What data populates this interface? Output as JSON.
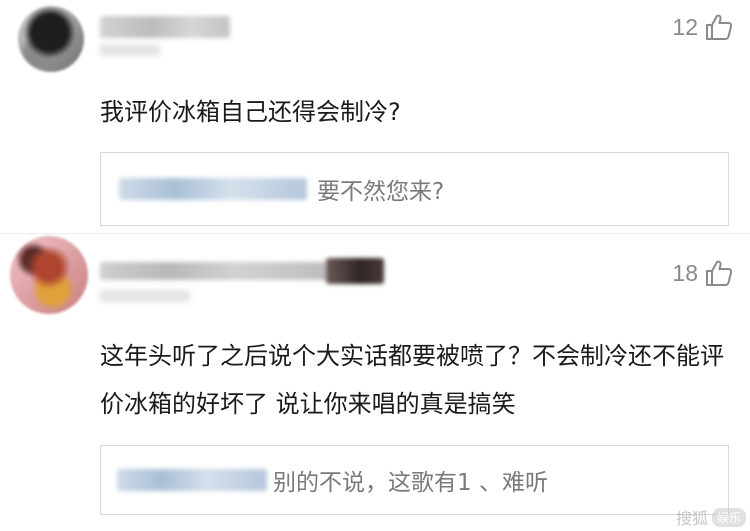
{
  "comments": [
    {
      "avatar_icon": "user-avatar-icon",
      "username_blurred": true,
      "likes": "12",
      "like_icon": "thumbs-up-icon",
      "text": "我评价冰箱自己还得会制冷?",
      "reply": {
        "author_blurred": true,
        "text": "要不然您来?"
      }
    },
    {
      "avatar_icon": "user-avatar-icon",
      "username_blurred": true,
      "likes": "18",
      "like_icon": "thumbs-up-icon",
      "text": "这年头听了之后说个大实话都要被喷了？不会制冷还不能评价冰箱的好坏了 说让你来唱的真是搞笑",
      "reply": {
        "author_blurred": true,
        "text": "别的不说，这歌有1 、难听"
      }
    }
  ],
  "watermark": {
    "text": "搜狐",
    "badge": "娱乐"
  },
  "colors": {
    "text_primary": "#1a1a1a",
    "text_secondary": "#7a7a7a",
    "like_gray": "#8a8a8a",
    "reply_border": "#d9d9d9"
  }
}
